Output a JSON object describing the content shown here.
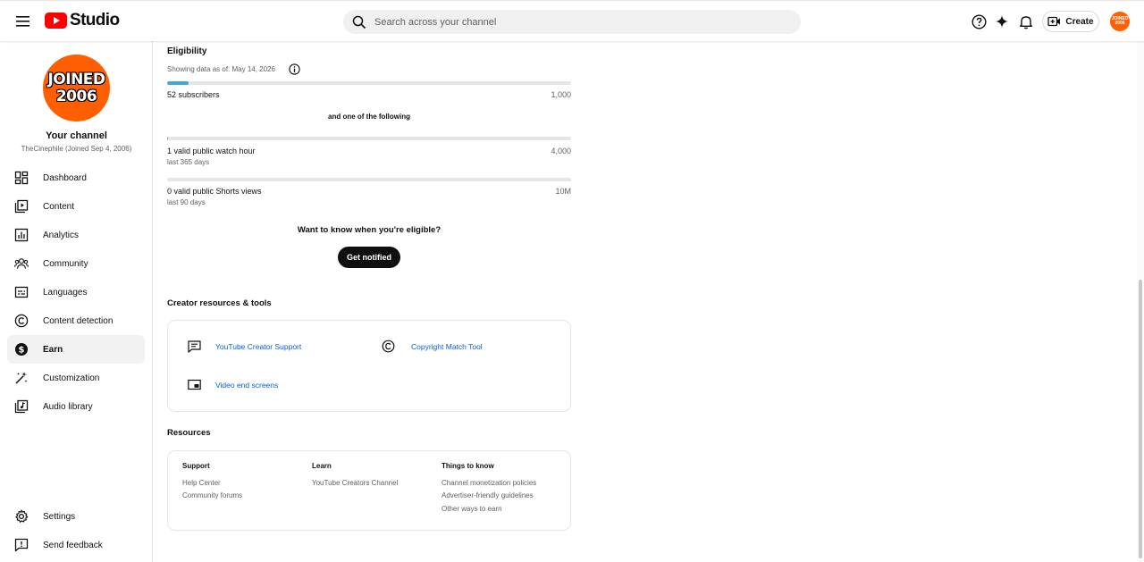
{
  "header": {
    "logo_text": "Studio",
    "search_placeholder": "Search across your channel",
    "create_label": "Create",
    "avatar_text_1": "JOINED",
    "avatar_text_2": "2006"
  },
  "sidebar": {
    "avatar_line1": "JOINED",
    "avatar_line2": "2006",
    "channel_title": "Your channel",
    "channel_subtitle": "TheCinephile (Joined Sep 4, 2006)",
    "items": [
      {
        "label": "Dashboard",
        "icon": "dashboard-icon"
      },
      {
        "label": "Content",
        "icon": "content-icon"
      },
      {
        "label": "Analytics",
        "icon": "analytics-icon"
      },
      {
        "label": "Community",
        "icon": "community-icon"
      },
      {
        "label": "Languages",
        "icon": "languages-icon"
      },
      {
        "label": "Content detection",
        "icon": "content-detection-icon"
      },
      {
        "label": "Earn",
        "icon": "earn-icon",
        "active": true
      },
      {
        "label": "Customization",
        "icon": "customization-icon"
      },
      {
        "label": "Audio library",
        "icon": "audio-library-icon"
      }
    ],
    "bottom_items": [
      {
        "label": "Settings",
        "icon": "gear-icon"
      },
      {
        "label": "Send feedback",
        "icon": "feedback-icon"
      }
    ]
  },
  "eligibility": {
    "title": "Eligibility",
    "data_as_of": "Showing data as of: May 14, 2026",
    "subscribers": {
      "label": "52 subscribers",
      "target": "1,000",
      "progress": 0.052
    },
    "one_of": "and one of the following",
    "watch_hours": {
      "label": "1 valid public watch hour",
      "period": "last 365 days",
      "target": "4,000",
      "progress": 0.00025
    },
    "shorts_views": {
      "label": "0 valid public Shorts views",
      "period": "last 90 days",
      "target": "10M",
      "progress": 0
    },
    "want_to_know": "Want to know when you're eligible?",
    "notify_button": "Get notified"
  },
  "creator_tools": {
    "title": "Creator resources & tools",
    "items": [
      {
        "label": "YouTube Creator Support",
        "icon": "chat-icon"
      },
      {
        "label": "Copyright Match Tool",
        "icon": "copyright-icon"
      },
      {
        "label": "Video end screens",
        "icon": "end-screen-icon"
      }
    ]
  },
  "resources": {
    "title": "Resources",
    "columns": [
      {
        "heading": "Support",
        "links": [
          "Help Center",
          "Community forums"
        ]
      },
      {
        "heading": "Learn",
        "links": [
          "YouTube Creators Channel"
        ]
      },
      {
        "heading": "Things to know",
        "links": [
          "Channel monetization policies",
          "Advertiser-friendly guidelines",
          "Other ways to earn"
        ]
      }
    ]
  },
  "colors": {
    "accent_red": "#ff0000",
    "avatar_orange": "#ff5f00",
    "progress_blue": "#41a7d4",
    "link_blue": "#065fd4"
  }
}
